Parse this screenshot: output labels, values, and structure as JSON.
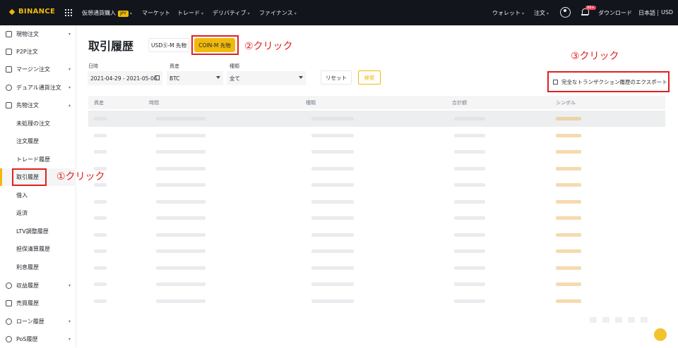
{
  "topbar": {
    "brand": "BINANCE",
    "nav": [
      "仮想通貨購入",
      "マーケット",
      "トレード",
      "デリバティブ",
      "ファイナンス"
    ],
    "jpy_badge": "JPY",
    "right": [
      "ウォレット",
      "注文",
      "ダウンロード",
      "日本語",
      "USD"
    ],
    "notification_count": "99+"
  },
  "sidebar": {
    "items": [
      {
        "label": "現物注文",
        "chev": "▾"
      },
      {
        "label": "P2P注文",
        "chev": ""
      },
      {
        "label": "マージン注文",
        "chev": "▾"
      },
      {
        "label": "デュアル通貨注文",
        "chev": "▾"
      },
      {
        "label": "先物注文",
        "chev": "▴"
      },
      {
        "label": "未処理の注文",
        "chev": ""
      },
      {
        "label": "注文履歴",
        "chev": ""
      },
      {
        "label": "トレード履歴",
        "chev": ""
      },
      {
        "label": "取引履歴",
        "chev": ""
      },
      {
        "label": "借入",
        "chev": ""
      },
      {
        "label": "返済",
        "chev": ""
      },
      {
        "label": "LTV調整履歴",
        "chev": ""
      },
      {
        "label": "担保清算履歴",
        "chev": ""
      },
      {
        "label": "利息履歴",
        "chev": ""
      },
      {
        "label": "収益履歴",
        "chev": "▾"
      },
      {
        "label": "売買履歴",
        "chev": ""
      },
      {
        "label": "ローン履歴",
        "chev": "▾"
      },
      {
        "label": "PoS履歴",
        "chev": "▾"
      }
    ]
  },
  "main": {
    "title": "取引履歴",
    "tabs": {
      "usd": "USDⓈ-M 先物",
      "coin": "COIN-M 先物"
    },
    "filters": {
      "date_label": "日時",
      "date_value": "2021-04-29 - 2021-05-06",
      "asset_label": "資産",
      "asset_value": "BTC",
      "type_label": "種類",
      "type_value": "全て"
    },
    "reset_label": "リセット",
    "search_label": "検索",
    "export_label": "完全なトランザクション履歴のエクスポート",
    "columns": [
      "資産",
      "時間",
      "種類",
      "合計額",
      "シンボル"
    ]
  },
  "annotations": {
    "a1": "①クリック",
    "a2": "②クリック",
    "a3": "③クリック"
  },
  "colors": {
    "accent": "#f0b90b",
    "annotation": "#e02020",
    "topbar": "#12161c"
  }
}
